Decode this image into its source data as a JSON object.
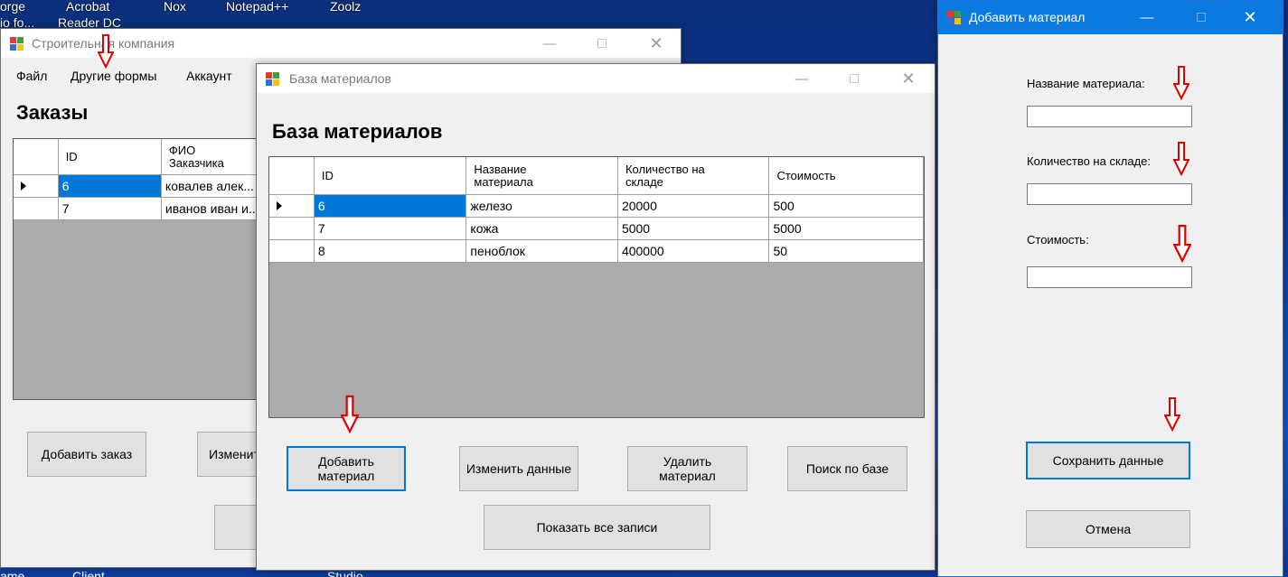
{
  "desktop": {
    "icons": [
      "orge",
      "Acrobat",
      "Reader DC",
      "Nox",
      "Notepad++",
      "Zoolz",
      "io fo..."
    ],
    "bottom_labels": [
      "ame",
      "Client",
      "Studio"
    ]
  },
  "main_window": {
    "title": "Строительная компания",
    "menu": [
      "Файл",
      "Другие формы",
      "Аккаунт"
    ],
    "heading": "Заказы",
    "columns": [
      "ID",
      "ФИО\nЗаказчика"
    ],
    "rows": [
      {
        "id": "6",
        "name": "ковалев алек..."
      },
      {
        "id": "7",
        "name": "иванов иван и..."
      }
    ],
    "buttons": {
      "add": "Добавить заказ",
      "edit": "Изменит"
    }
  },
  "materials_window": {
    "title": "База материалов",
    "heading": "База материалов",
    "columns": [
      "ID",
      "Название\nматериала",
      "Количество на\nскладе",
      "Стоимость"
    ],
    "rows": [
      {
        "id": "6",
        "name": "железо",
        "qty": "20000",
        "cost": "500"
      },
      {
        "id": "7",
        "name": "кожа",
        "qty": "5000",
        "cost": "5000"
      },
      {
        "id": "8",
        "name": "пеноблок",
        "qty": "400000",
        "cost": "50"
      }
    ],
    "buttons": {
      "add": "Добавить\nматериал",
      "edit": "Изменить данные",
      "delete": "Удалить\nматериал",
      "search": "Поиск по базе",
      "show_all": "Показать все записи"
    }
  },
  "add_window": {
    "title": "Добавить материал",
    "labels": {
      "name": "Название материала:",
      "qty": "Количество на складе:",
      "cost": "Стоимость:"
    },
    "fields": {
      "name": "",
      "qty": "",
      "cost": ""
    },
    "buttons": {
      "save": "Сохранить данные",
      "cancel": "Отмена"
    }
  },
  "colors": {
    "selection": "#0078d7",
    "annotation_arrow": "#e00000",
    "desktop": "#0a3d9c"
  }
}
